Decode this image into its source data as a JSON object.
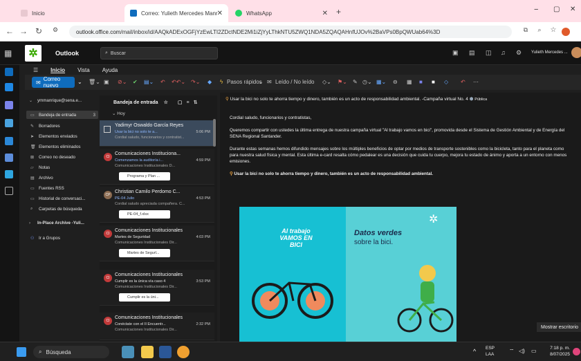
{
  "browser": {
    "tabs": [
      {
        "label": "Inicio",
        "color": "#e8c8d0"
      },
      {
        "label": "Correo: Yulieth Mercedes Manr",
        "color": "#0f6cbd"
      },
      {
        "label": "WhatsApp",
        "color": "#25d366"
      }
    ],
    "url_prefix": "outlook.office.com",
    "url_rest": "/mail/inbox/id/AAQkADExOGFjYzEwLTI2ZDctNDE2Mi1iZjYyLThkNTU5ZWQ1NDA5ZQAQAHnfUJOv%2BaVPs0BpQWUab64%3D",
    "window_min": "−",
    "window_max": "▢",
    "window_close": "✕"
  },
  "header": {
    "app_title": "Outlook",
    "search_placeholder": "Buscar",
    "user_name": "Yulieth Mercedes ..."
  },
  "menu": {
    "inicio": "Inicio",
    "vista": "Vista",
    "ayuda": "Ayuda"
  },
  "ribbon": {
    "new_mail": "Correo nuevo",
    "quick_steps": "Pasos rápidos",
    "read_unread": "Leído / No leído"
  },
  "folders": {
    "account": "ymmanrique@sena.e...",
    "items": [
      {
        "label": "Bandeja de entrada",
        "count": "3",
        "icon": "inbox-icon"
      },
      {
        "label": "Borradores",
        "count": "",
        "icon": "pencil-icon"
      },
      {
        "label": "Elementos enviados",
        "count": "",
        "icon": "send-icon"
      },
      {
        "label": "Elementos eliminados",
        "count": "",
        "icon": "trash-icon"
      },
      {
        "label": "Correo no deseado",
        "count": "",
        "icon": "junk-icon"
      },
      {
        "label": "Notas",
        "count": "",
        "icon": "note-icon"
      },
      {
        "label": "Archivo",
        "count": "",
        "icon": "archive-icon"
      },
      {
        "label": "Fuentes RSS",
        "count": "",
        "icon": "rss-icon"
      },
      {
        "label": "Historial de conversaci...",
        "count": "",
        "icon": "history-icon"
      },
      {
        "label": "Carpetas de búsqueda",
        "count": "",
        "icon": "search-folder-icon"
      }
    ],
    "archive": "In-Place Archive -Yuli...",
    "groups": "Ir a Grupos"
  },
  "list": {
    "header": "Bandeja de entrada",
    "group_today": "Hoy",
    "messages": [
      {
        "sender": "Yadimyr Oswaldo García Reyes",
        "subject": "Usar la bici no solo te a...",
        "time": "5:06 PM",
        "preview": "Cordial saludo, funcionarios y contratist...",
        "attachment": ""
      },
      {
        "sender": "Comunicaciones Instituciona...",
        "subject": "Comenzamos la auditoría i...",
        "time": "4:59 PM",
        "preview": "Comunicaciones Institucionales D...",
        "attachment": "Programa y Plan ..."
      },
      {
        "sender": "Christian Camilo Perdomo C...",
        "subject": "PE-04 Julio",
        "time": "4:53 PM",
        "preview": "Cordial saludo apreciada compañera. C...",
        "attachment": "PE-04_f.xlsx"
      },
      {
        "sender": "Comunicaciones Institucionales",
        "subject": "Martes de Seguridad",
        "time": "4:03 PM",
        "preview": "Comunicaciones Institucionales Dir...",
        "attachment": "Martes de Segurl..."
      },
      {
        "sender": "Comunicaciones Institucionales",
        "subject": "Cumplir es la única vía caso 4",
        "time": "3:53 PM",
        "preview": "Comunicaciones Institucionales Dir...",
        "attachment": "Cumplir es la úni..."
      },
      {
        "sender": "Comunicaciones Institucionales",
        "subject": "Conéctate con el II Encuentr...",
        "time": "2:32 PM",
        "preview": "Comunicaciones Institucionales Dir...",
        "attachment": ""
      }
    ]
  },
  "reading": {
    "subject": "Usar la bici no solo te ahorra tiempo y dinero, también es un acto de responsabilidad ambiental. -Campaña virtual No. 4",
    "tag": "Pública",
    "greeting": "Cordial saludo, funcionarios y contratistas,",
    "p1": "Queremos compartir con ustedes la última entrega de nuestra campaña virtual \"Al trabajo vamos en bici\", promovida desde el Sistema de Gestión Ambiental y de Energía del SENA Regional Santander.",
    "p2": "Durante estas semanas hemos difundido mensajes sobre los múltiples beneficios de optar por medios de transporte sostenibles como la bicicleta, tanto para el planeta como para nuestra salud física y mental. Esta última e-card resalta cómo pedalear es una decisión que cuida tu cuerpo, mejora tu estado de ánimo y aporta a un entorno con menos emisiones.",
    "p3": "Usar la bici no solo te ahorra tiempo y dinero, también es un acto de responsabilidad ambiental.",
    "banner_left_title": "Al trabajo VAMOS EN BICI",
    "banner_right_title": "Datos verdes",
    "banner_right_sub": "sobre la bici."
  },
  "overlay": {
    "mostrar": "Mostrar escritorio"
  },
  "taskbar": {
    "search": "Búsqueda",
    "lang": "ESP",
    "lang2": "LAA",
    "time": "7:18 p. m.",
    "date": "8/07/2025"
  },
  "colors": {
    "accent": "#0f6cbd",
    "sena_green": "#39a900"
  }
}
